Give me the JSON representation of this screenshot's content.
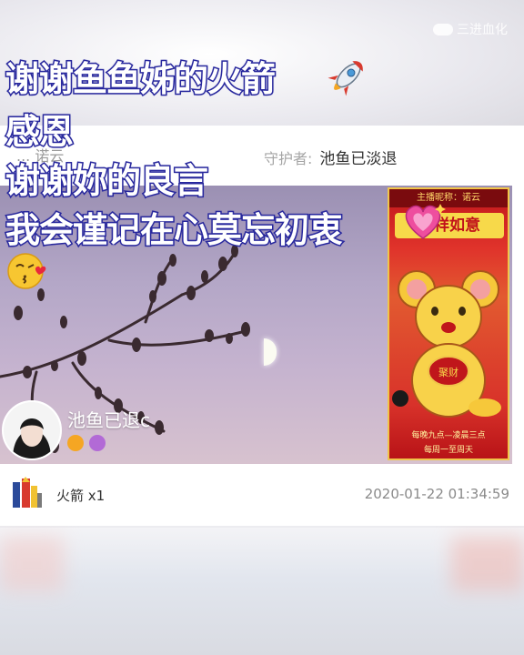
{
  "watermark": {
    "text": "三进血化"
  },
  "overlay": {
    "line1": "谢谢鱼鱼姊的火箭",
    "line2": "感恩",
    "line3": "谢谢妳的良言",
    "line4": "我会谨记在心莫忘初衷",
    "emoji_rocket": "rocket-emoji",
    "emoji_heart": "sparkling-heart-emoji",
    "emoji_kiss": "kiss-face-emoji"
  },
  "card": {
    "header_left": "... 诺云",
    "guard_label": "守护者:",
    "guard_name": "池鱼已淡退"
  },
  "stream": {
    "streamer_name": "池鱼已退c",
    "poster": {
      "top_text": "主播昵称：诺云",
      "banner_text": "吉祥如意",
      "seal_text": "聚财",
      "footer_line1": "每晚九点—凌晨三点",
      "footer_line2": "每周一至周天"
    }
  },
  "gift": {
    "text": "火箭 x1",
    "time": "2020-01-22 01:34:59",
    "icon": "rocket-gift-icon"
  },
  "colors": {
    "overlay_stroke": "#2a2a9e",
    "overlay_fill": "#ffffff",
    "poster_red": "#d8322a",
    "poster_gold": "#f7d94a"
  }
}
